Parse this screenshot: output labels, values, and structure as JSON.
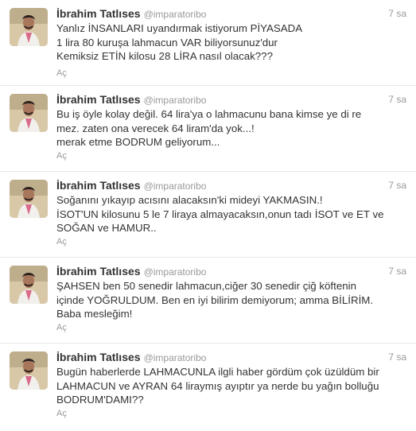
{
  "tweets": [
    {
      "name": "İbrahim Tatlıses",
      "handle": "@imparatoribo",
      "time": "7 sa",
      "lines": [
        "Yanlız İNSANLARI  uyandırmak istiyorum PİYASADA",
        "1 lira 80 kuruşa lahmacun VAR biliyorsunuz'dur",
        "Kemiksiz ETİN kilosu 28 LİRA nasıl olacak???"
      ],
      "expand": "Aç"
    },
    {
      "name": "İbrahim Tatlıses",
      "handle": "@imparatoribo",
      "time": "7 sa",
      "lines": [
        "Bu iş öyle kolay değil. 64 lira'ya o lahmacunu bana kimse ye di re",
        "mez. zaten ona verecek 64 liram'da yok...!",
        "merak etme BODRUM geliyorum..."
      ],
      "expand": "Aç"
    },
    {
      "name": "İbrahim Tatlıses",
      "handle": "@imparatoribo",
      "time": "7 sa",
      "lines": [
        "Soğanını yıkayıp acısını alacaksın'ki mideyi YAKMASIN.!",
        "İSOT'UN kilosunu 5 le 7 liraya almayacaksın,onun tadı İSOT ve ET ve",
        "SOĞAN ve HAMUR.."
      ],
      "expand": "Aç"
    },
    {
      "name": "İbrahim Tatlıses",
      "handle": "@imparatoribo",
      "time": "7 sa",
      "lines": [
        "ŞAHSEN ben 50 senedir lahmacun,ciğer 30 senedir çiğ köftenin",
        "içinde YOĞRULDUM. Ben en iyi bilirim demiyorum; amma BİLİRİM.",
        "Baba mesleğim!"
      ],
      "expand": "Aç"
    },
    {
      "name": "İbrahim Tatlıses",
      "handle": "@imparatoribo",
      "time": "7 sa",
      "lines": [
        "Bugün haberlerde LAHMACUNLA ilgli haber gördüm çok üzüldüm bir",
        "LAHMACUN ve AYRAN 64 liraymış ayıptır ya nerde bu yağın bolluğu",
        "BODRUM'DAMI??"
      ],
      "expand": "Aç"
    }
  ]
}
